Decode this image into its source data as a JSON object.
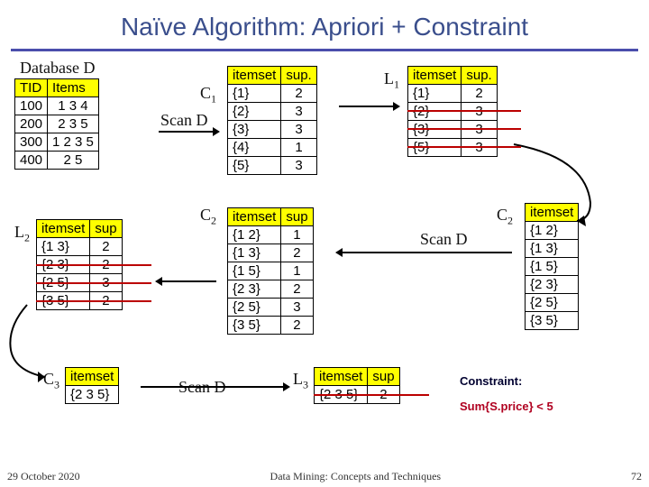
{
  "title": "Naïve Algorithm: Apriori + Constraint",
  "labels": {
    "databaseD": "Database D",
    "C1": "C",
    "C1_sub": "1",
    "L1": "L",
    "L1_sub": "1",
    "C2a": "C",
    "C2a_sub": "2",
    "C2b": "C",
    "C2b_sub": "2",
    "L2": "L",
    "L2_sub": "2",
    "C3": "C",
    "C3_sub": "3",
    "L3": "L",
    "L3_sub": "3",
    "scanD1": "Scan D",
    "scanD2": "Scan D",
    "scanD3": "Scan D"
  },
  "D": {
    "headers": [
      "TID",
      "Items"
    ],
    "rows": [
      [
        "100",
        "1 3 4"
      ],
      [
        "200",
        "2 3 5"
      ],
      [
        "300",
        "1 2 3 5"
      ],
      [
        "400",
        "2 5"
      ]
    ]
  },
  "C1": {
    "headers": [
      "itemset",
      "sup."
    ],
    "rows": [
      [
        "{1}",
        "2"
      ],
      [
        "{2}",
        "3"
      ],
      [
        "{3}",
        "3"
      ],
      [
        "{4}",
        "1"
      ],
      [
        "{5}",
        "3"
      ]
    ]
  },
  "L1_table": {
    "headers": [
      "itemset",
      "sup."
    ],
    "rows": [
      [
        "{1}",
        "2"
      ],
      [
        "{2}",
        "3"
      ],
      [
        "{3}",
        "3"
      ],
      [
        "{5}",
        "3"
      ]
    ],
    "struck": [
      1,
      2,
      3
    ]
  },
  "C2_items": {
    "headers": [
      "itemset"
    ],
    "rows": [
      [
        "{1 2}"
      ],
      [
        "{1 3}"
      ],
      [
        "{1 5}"
      ],
      [
        "{2 3}"
      ],
      [
        "{2 5}"
      ],
      [
        "{3 5}"
      ]
    ]
  },
  "C2_sup": {
    "headers": [
      "itemset",
      "sup"
    ],
    "rows": [
      [
        "{1 2}",
        "1"
      ],
      [
        "{1 3}",
        "2"
      ],
      [
        "{1 5}",
        "1"
      ],
      [
        "{2 3}",
        "2"
      ],
      [
        "{2 5}",
        "3"
      ],
      [
        "{3 5}",
        "2"
      ]
    ]
  },
  "L2_table": {
    "headers": [
      "itemset",
      "sup"
    ],
    "rows": [
      [
        "{1 3}",
        "2"
      ],
      [
        "{2 3}",
        "2"
      ],
      [
        "{2 5}",
        "3"
      ],
      [
        "{3 5}",
        "2"
      ]
    ],
    "struck": [
      1,
      2,
      3
    ]
  },
  "C3_table": {
    "headers": [
      "itemset"
    ],
    "rows": [
      [
        "{2 3 5}"
      ]
    ]
  },
  "L3_table": {
    "headers": [
      "itemset",
      "sup"
    ],
    "rows": [
      [
        "{2 3 5}",
        "2"
      ]
    ],
    "struck": [
      0
    ]
  },
  "constraint": {
    "title": "Constraint:",
    "rule": "Sum{S.price} < 5"
  },
  "footer": {
    "date": "29 October 2020",
    "center": "Data Mining: Concepts and Techniques",
    "num": "72"
  }
}
